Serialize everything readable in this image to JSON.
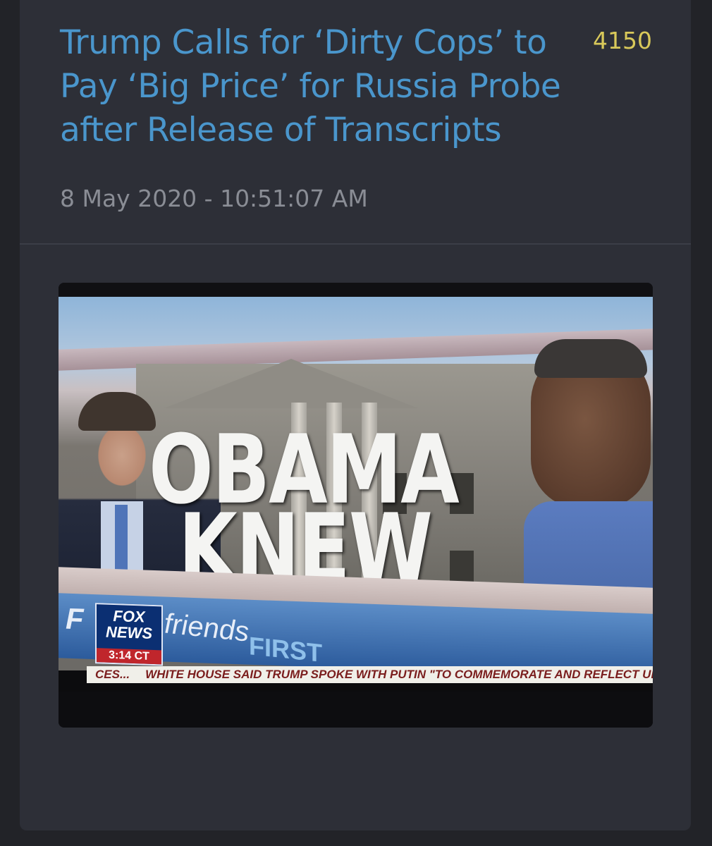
{
  "post": {
    "headline": "Trump Calls for ‘Dirty Cops’ to Pay ‘Big Price’ for Russia Probe after Release of Transcripts",
    "score": "4150",
    "timestamp": "8 May 2020 - 10:51:07 AM"
  },
  "media": {
    "overlay_line_1": "OBAMA",
    "overlay_line_2": "KNEW",
    "fox_logo_line_1": "FOX",
    "fox_logo_line_2": "NEWS",
    "fox_time": "3:14 CT",
    "show_name": "friends",
    "show_name_2": "FIRST",
    "ticker_prefix": "CES...",
    "ticker_text": "WHITE HOUSE SAID TRUMP SPOKE WITH PUTIN \"TO COMMEMORATE AND REFLECT UPON T"
  },
  "colors": {
    "headline": "#4a96cc",
    "score": "#d8c85a",
    "timestamp": "#8a8d95",
    "card_background": "#2d2f37",
    "page_background": "#222328"
  }
}
